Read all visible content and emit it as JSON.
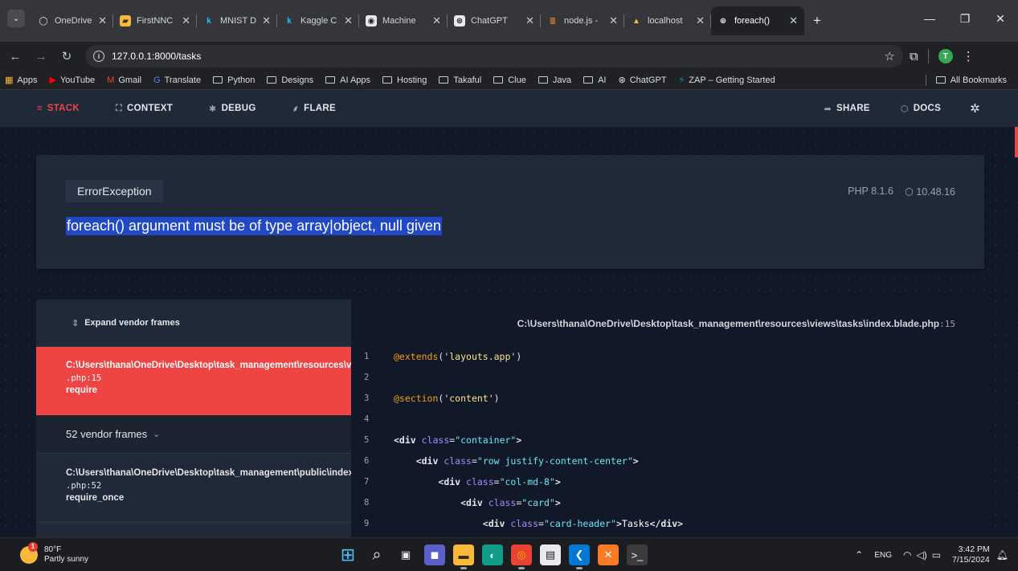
{
  "browser": {
    "tabs": [
      {
        "label": "OneDrive",
        "icon": "onedrive-icon",
        "glyph": "◯",
        "bg": "transparent",
        "color": "#e8eaed",
        "width": 102
      },
      {
        "label": "FirstNNC",
        "icon": "firstnnc-icon",
        "glyph": "▰",
        "bg": "#f6b93b",
        "color": "#3a2a00",
        "width": 104
      },
      {
        "label": "MNIST D",
        "icon": "kaggle-icon",
        "glyph": "k",
        "bg": "transparent",
        "color": "#20beff",
        "width": 100
      },
      {
        "label": "Kaggle C",
        "icon": "kaggle-icon",
        "glyph": "k",
        "bg": "transparent",
        "color": "#20beff",
        "width": 102
      },
      {
        "label": "Machine",
        "icon": "machine-icon",
        "glyph": "◉",
        "bg": "#e8eaed",
        "color": "#202124",
        "width": 110
      },
      {
        "label": "ChatGPT",
        "icon": "chatgpt-icon",
        "glyph": "⊛",
        "bg": "#e8eaed",
        "color": "#202124",
        "width": 116
      },
      {
        "label": "node.js -",
        "icon": "stackoverflow-icon",
        "glyph": "≣",
        "bg": "transparent",
        "color": "#f48024",
        "width": 104
      },
      {
        "label": "localhost",
        "icon": "xampp-icon",
        "glyph": "▲",
        "bg": "transparent",
        "color": "#f6b93b",
        "width": 108
      },
      {
        "label": "foreach()",
        "icon": "globe-icon",
        "glyph": "⊕",
        "bg": "transparent",
        "color": "#e8eaed",
        "width": 116,
        "active": true
      }
    ],
    "new_tab": "+",
    "address": "127.0.0.1:8000/tasks",
    "bookmarks": [
      {
        "label": "Apps",
        "type": "apps",
        "glyph": "▦",
        "color": "#f6b93b"
      },
      {
        "label": "YouTube",
        "type": "icon",
        "glyph": "▶",
        "color": "#ff0000"
      },
      {
        "label": "Gmail",
        "type": "icon",
        "glyph": "M",
        "color": "#ea4335"
      },
      {
        "label": "Translate",
        "type": "icon",
        "glyph": "G",
        "color": "#4285f4"
      },
      {
        "label": "Python",
        "type": "folder"
      },
      {
        "label": "Designs",
        "type": "folder"
      },
      {
        "label": "AI Apps",
        "type": "folder"
      },
      {
        "label": "Hosting",
        "type": "folder"
      },
      {
        "label": "Takaful",
        "type": "folder"
      },
      {
        "label": "Clue",
        "type": "folder"
      },
      {
        "label": "Java",
        "type": "folder"
      },
      {
        "label": "AI",
        "type": "folder"
      },
      {
        "label": "ChatGPT",
        "type": "icon",
        "glyph": "⊛",
        "color": "#e8eaed"
      },
      {
        "label": "ZAP – Getting Started",
        "type": "icon",
        "glyph": "⚡",
        "color": "#00a1e0"
      }
    ],
    "all_bookmarks": "All Bookmarks",
    "profile_initial": "T"
  },
  "ignition": {
    "nav": {
      "stack": "STACK",
      "context": "CONTEXT",
      "debug": "DEBUG",
      "flare": "FLARE",
      "share": "SHARE",
      "docs": "DOCS"
    },
    "error": {
      "class": "ErrorException",
      "php_version": "PHP 8.1.6",
      "laravel_version": "10.48.16",
      "message": "foreach() argument must be of type array|object, null given"
    },
    "frames": {
      "expand_label": "Expand vendor frames",
      "active": {
        "path": "C:\\Users\\thana\\OneDrive\\Desktop\\task_management\\resources\\views\\tasks\\index.blade",
        "line": ".php:15",
        "fn": "require"
      },
      "vendor_label": "52 vendor frames",
      "second": {
        "path": "C:\\Users\\thana\\OneDrive\\Desktop\\task_management\\public\\index",
        "line": ".php:52",
        "fn": "require_once"
      }
    },
    "code": {
      "file": "C:\\Users\\thana\\OneDrive\\Desktop\\task_management\\resources\\views\\tasks\\index.blade.php",
      "line_ref": ":15",
      "lines": [
        {
          "n": "1",
          "indent": "",
          "parts": [
            {
              "t": "@extends",
              "c": "c-dir"
            },
            {
              "t": "('",
              "c": "src"
            },
            {
              "t": "layouts.app",
              "c": "c-str"
            },
            {
              "t": "')",
              "c": "src"
            }
          ]
        },
        {
          "n": "2",
          "indent": "",
          "parts": []
        },
        {
          "n": "3",
          "indent": "",
          "parts": [
            {
              "t": "@section",
              "c": "c-dir"
            },
            {
              "t": "('",
              "c": "src"
            },
            {
              "t": "content",
              "c": "c-str"
            },
            {
              "t": "')",
              "c": "src"
            }
          ]
        },
        {
          "n": "4",
          "indent": "",
          "parts": []
        },
        {
          "n": "5",
          "indent": "",
          "parts": [
            {
              "t": "<div",
              "c": "c-tag"
            },
            {
              "t": " class",
              "c": "c-attr"
            },
            {
              "t": "=",
              "c": "src"
            },
            {
              "t": "\"container\"",
              "c": "c-val"
            },
            {
              "t": ">",
              "c": "c-tag"
            }
          ]
        },
        {
          "n": "6",
          "indent": "    ",
          "parts": [
            {
              "t": "<div",
              "c": "c-tag"
            },
            {
              "t": " class",
              "c": "c-attr"
            },
            {
              "t": "=",
              "c": "src"
            },
            {
              "t": "\"row justify-content-center\"",
              "c": "c-val"
            },
            {
              "t": ">",
              "c": "c-tag"
            }
          ]
        },
        {
          "n": "7",
          "indent": "        ",
          "parts": [
            {
              "t": "<div",
              "c": "c-tag"
            },
            {
              "t": " class",
              "c": "c-attr"
            },
            {
              "t": "=",
              "c": "src"
            },
            {
              "t": "\"col-md-8\"",
              "c": "c-val"
            },
            {
              "t": ">",
              "c": "c-tag"
            }
          ]
        },
        {
          "n": "8",
          "indent": "            ",
          "parts": [
            {
              "t": "<div",
              "c": "c-tag"
            },
            {
              "t": " class",
              "c": "c-attr"
            },
            {
              "t": "=",
              "c": "src"
            },
            {
              "t": "\"card\"",
              "c": "c-val"
            },
            {
              "t": ">",
              "c": "c-tag"
            }
          ]
        },
        {
          "n": "9",
          "indent": "                ",
          "parts": [
            {
              "t": "<div",
              "c": "c-tag"
            },
            {
              "t": " class",
              "c": "c-attr"
            },
            {
              "t": "=",
              "c": "src"
            },
            {
              "t": "\"card-header\"",
              "c": "c-val"
            },
            {
              "t": ">",
              "c": "c-tag"
            },
            {
              "t": "Tasks",
              "c": "c-txt"
            },
            {
              "t": "</div>",
              "c": "c-tag"
            }
          ]
        }
      ]
    }
  },
  "taskbar": {
    "weather_temp": "80°F",
    "weather_desc": "Partly sunny",
    "weather_badge": "1",
    "language": "ENG",
    "time": "3:42 PM",
    "date": "7/15/2024",
    "apps": [
      {
        "name": "start-button",
        "glyph": "⊞",
        "bg": "transparent",
        "color": "#4cc2ff"
      },
      {
        "name": "search-icon",
        "glyph": "⌕",
        "bg": "transparent",
        "color": "#e8eaed"
      },
      {
        "name": "task-view-icon",
        "glyph": "▣",
        "bg": "transparent",
        "color": "#e8eaed"
      },
      {
        "name": "meet-icon",
        "glyph": "◼",
        "bg": "#5b5fc7",
        "color": "#ffffff"
      },
      {
        "name": "file-explorer-icon",
        "glyph": "▬",
        "bg": "#f6b93b",
        "color": "#3a2a00",
        "running": true
      },
      {
        "name": "edge-icon",
        "glyph": "◐",
        "bg": "#0f9d8a",
        "color": "#ffffff"
      },
      {
        "name": "chrome-icon",
        "glyph": "◎",
        "bg": "#ea4335",
        "color": "#fbbc05",
        "running": true
      },
      {
        "name": "store-icon",
        "glyph": "▤",
        "bg": "#e8eaed",
        "color": "#202124"
      },
      {
        "name": "vscode-icon",
        "glyph": "❮",
        "bg": "#0078d4",
        "color": "#ffffff",
        "running": true
      },
      {
        "name": "xampp-icon",
        "glyph": "✕",
        "bg": "#fb7a24",
        "color": "#ffffff"
      },
      {
        "name": "terminal-icon",
        "glyph": ">_",
        "bg": "#3c3c3c",
        "color": "#ffffff"
      }
    ]
  }
}
